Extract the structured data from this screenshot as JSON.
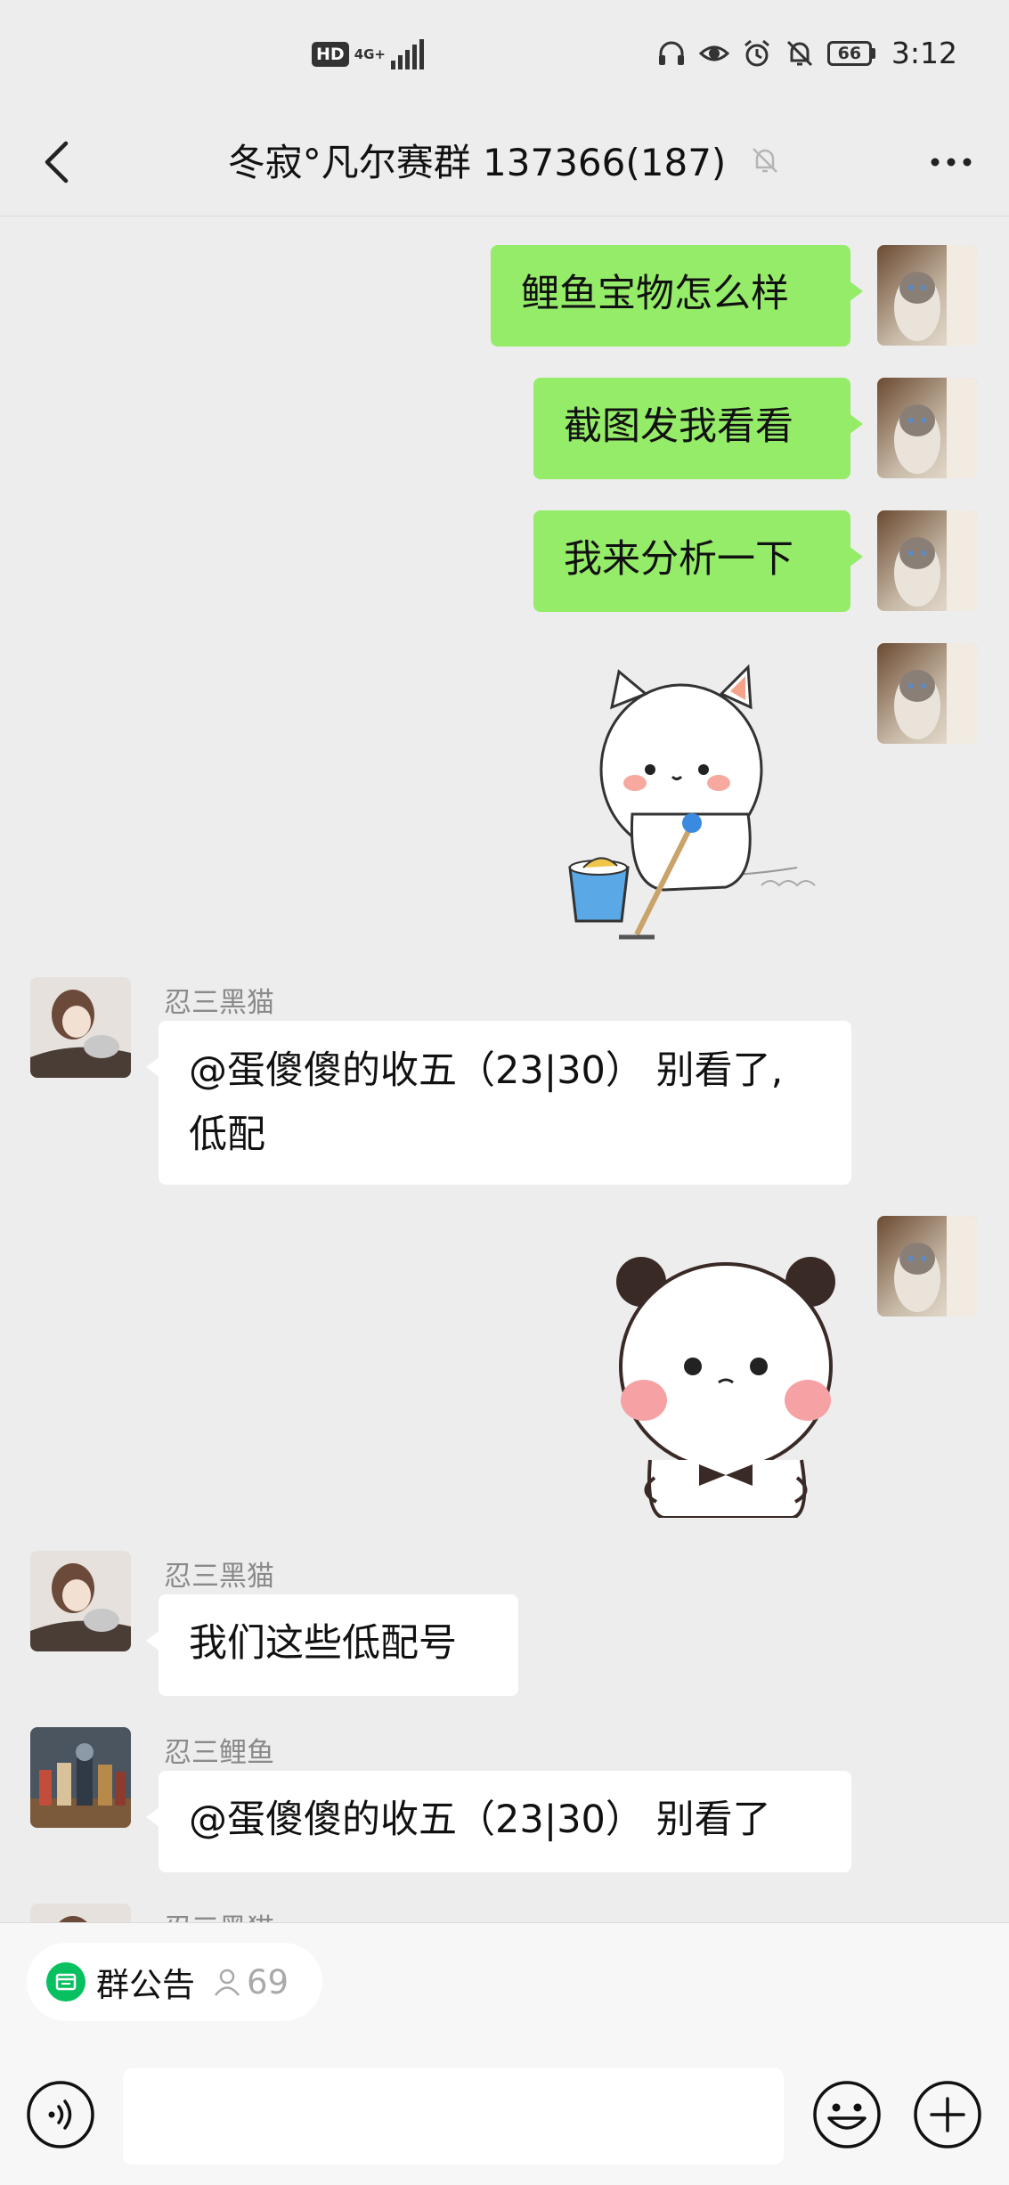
{
  "status_bar": {
    "hd": "HD",
    "network": "4G+",
    "battery": "66",
    "time": "3:12"
  },
  "header": {
    "title": "冬寂°凡尔赛群 137366(187)"
  },
  "messages": {
    "m1": {
      "text": "鲤鱼宝物怎么样"
    },
    "m2": {
      "text": "截图发我看看"
    },
    "m3": {
      "text": "我来分析一下"
    },
    "m5": {
      "sender": "忍三黑猫",
      "line1": "@蛋傻傻的收五（23|30） 别看了,",
      "line2": "低配"
    },
    "m7": {
      "sender": "忍三黑猫",
      "text": "我们这些低配号"
    },
    "m8": {
      "sender": "忍三鲤鱼",
      "text": "@蛋傻傻的收五（23|30） 别看了"
    },
    "m9": {
      "sender": "忍三黑猫"
    }
  },
  "bottom": {
    "notice_label": "群公告",
    "member_count": "69"
  },
  "colors": {
    "outgoing_bubble": "#95ec69",
    "incoming_bubble": "#ffffff",
    "background": "#ededed",
    "notice_icon": "#07c160"
  },
  "icons": {
    "back": "chevron-left-icon",
    "mute": "bell-off-icon",
    "more": "more-dots-icon",
    "voice": "voice-icon",
    "emoji": "emoji-icon",
    "plus": "plus-circle-icon",
    "notice": "announcement-icon",
    "person": "person-icon"
  }
}
